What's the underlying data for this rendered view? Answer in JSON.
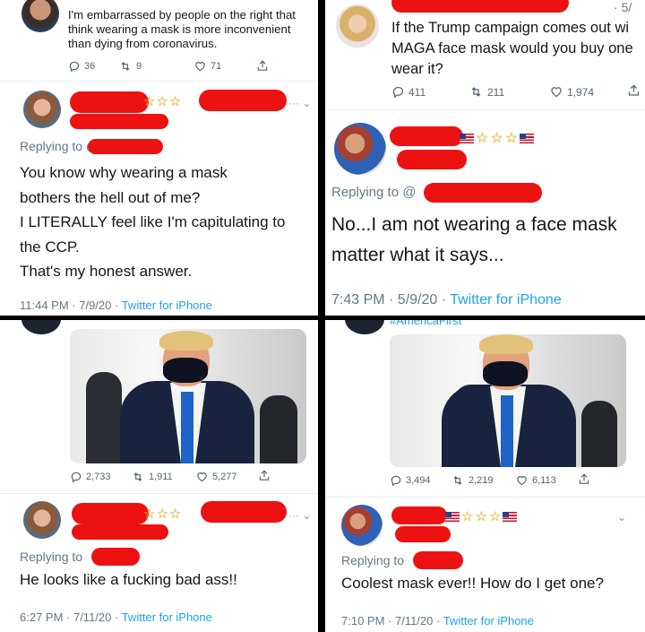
{
  "colors": {
    "redaction": "#ec1212",
    "twitter_blue": "#1da1f2",
    "grey_text": "#657786"
  },
  "p1": {
    "quoted_text": "I'm embarrassed by people on the right that think wearing a mask is more inconvenient than dying from coronavirus.",
    "replies": "36",
    "retweets": "9",
    "likes": "71",
    "replying_to": "Replying to @",
    "reply_lines": [
      "You know why wearing a mask",
      "bothers the hell out of me?",
      "I LITERALLY feel like I'm capitulating to",
      "the CCP.",
      "That's my honest answer."
    ],
    "timestamp": "11:44 PM · 7/9/20 · ",
    "source": "Twitter for iPhone"
  },
  "p2": {
    "header_date": "· 5/",
    "quoted_text_lines": [
      "If the Trump campaign comes out wi",
      "MAGA face mask would you buy one",
      "wear it?"
    ],
    "replies": "411",
    "retweets": "211",
    "likes": "1,974",
    "replying_to": "Replying to @",
    "reply_lines": [
      "No...I am not wearing a face mask",
      "matter what it says..."
    ],
    "timestamp": "7:43 PM · 5/9/20 · ",
    "source": "Twitter for iPhone"
  },
  "p3": {
    "replies": "2,733",
    "retweets": "1,911",
    "likes": "5,277",
    "replying_to": "Replying to",
    "reply_text": "He looks like a fucking bad ass!!",
    "timestamp": "6:27 PM · 7/11/20 · ",
    "source": "Twitter for iPhone"
  },
  "p4": {
    "hashtag": "#AmericaFirst",
    "replies": "3,494",
    "retweets": "2,219",
    "likes": "6,113",
    "replying_to": "Replying to",
    "reply_text": "Coolest mask ever!! How do I get one?",
    "timestamp": "7:10 PM · 7/11/20 · ",
    "source": "Twitter for iPhone"
  },
  "icons": [
    "reply-icon",
    "retweet-icon",
    "like-icon",
    "share-icon",
    "star-icon",
    "us-flag-icon",
    "chevron-down-icon"
  ]
}
